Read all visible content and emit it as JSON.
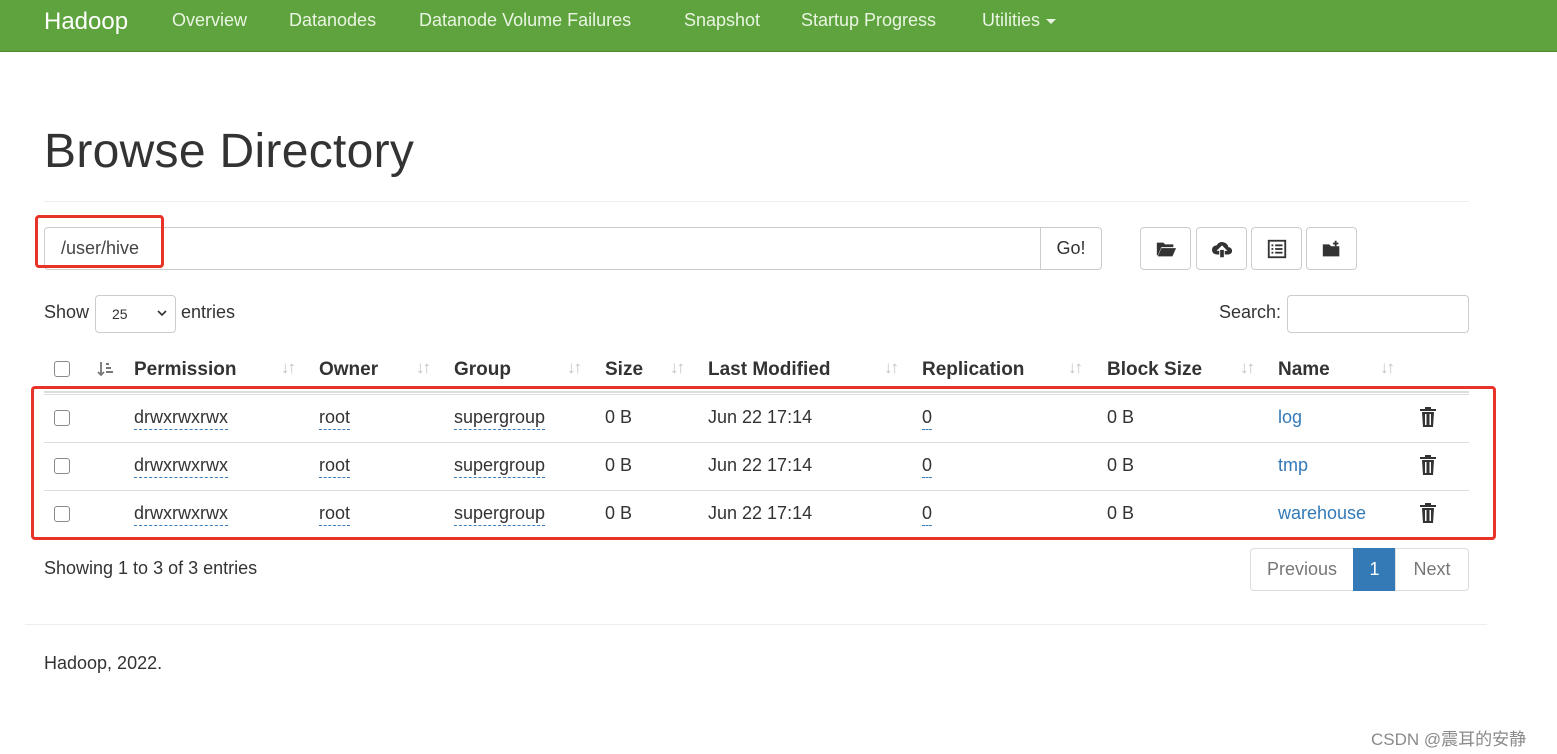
{
  "navbar": {
    "brand": "Hadoop",
    "items": [
      "Overview",
      "Datanodes",
      "Datanode Volume Failures",
      "Snapshot",
      "Startup Progress",
      "Utilities"
    ]
  },
  "page": {
    "title": "Browse Directory"
  },
  "path": {
    "value": "/user/hive",
    "go_label": "Go!"
  },
  "toolbar": {
    "icons": [
      "folder-open-icon",
      "cloud-upload-icon",
      "list-icon",
      "create-folder-icon"
    ]
  },
  "table_controls": {
    "show_label": "Show",
    "entries_selected": "25",
    "entries_label": "entries",
    "search_label": "Search:",
    "search_value": ""
  },
  "table": {
    "columns": [
      "Permission",
      "Owner",
      "Group",
      "Size",
      "Last Modified",
      "Replication",
      "Block Size",
      "Name"
    ],
    "rows": [
      {
        "permission": "drwxrwxrwx",
        "owner": "root",
        "group": "supergroup",
        "size": "0 B",
        "last_modified": "Jun 22 17:14",
        "replication": "0",
        "block_size": "0 B",
        "name": "log"
      },
      {
        "permission": "drwxrwxrwx",
        "owner": "root",
        "group": "supergroup",
        "size": "0 B",
        "last_modified": "Jun 22 17:14",
        "replication": "0",
        "block_size": "0 B",
        "name": "tmp"
      },
      {
        "permission": "drwxrwxrwx",
        "owner": "root",
        "group": "supergroup",
        "size": "0 B",
        "last_modified": "Jun 22 17:14",
        "replication": "0",
        "block_size": "0 B",
        "name": "warehouse"
      }
    ]
  },
  "pagination": {
    "info": "Showing 1 to 3 of 3 entries",
    "previous_label": "Previous",
    "current_page": "1",
    "next_label": "Next"
  },
  "footer": {
    "copyright": "Hadoop, 2022."
  },
  "watermark": "CSDN @震耳的安静",
  "colors": {
    "navbar": "#5fa33e",
    "link": "#337ab7",
    "active_page": "#337ab7",
    "annotation_red": "#e8332a"
  }
}
